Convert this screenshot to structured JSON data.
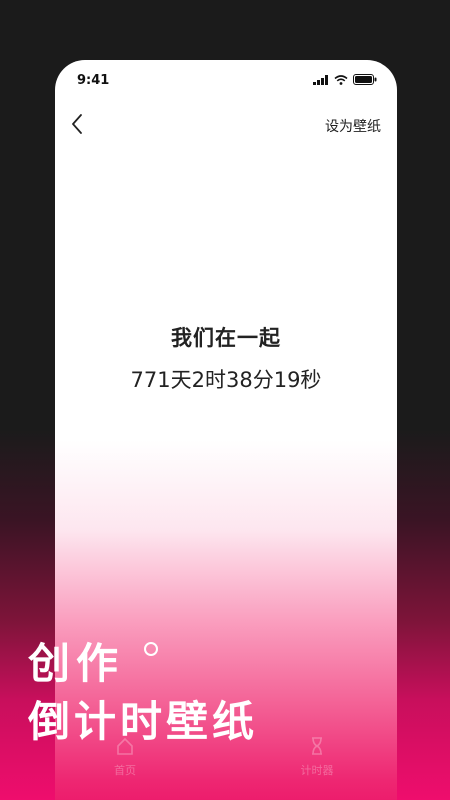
{
  "status_bar": {
    "time": "9:41"
  },
  "nav": {
    "set_wallpaper_label": "设为壁纸"
  },
  "content": {
    "title": "我们在一起",
    "timer": "771天2时38分19秒"
  },
  "tab_bar": {
    "items": [
      {
        "label": "首页",
        "icon": "home-icon"
      },
      {
        "label": "计时器",
        "icon": "hourglass-icon"
      }
    ]
  },
  "overlay": {
    "line1": "创作",
    "line2": "倒计时壁纸"
  },
  "colors": {
    "dark_bg": "#1b1b1b",
    "accent_pink": "#ef0d6d"
  }
}
